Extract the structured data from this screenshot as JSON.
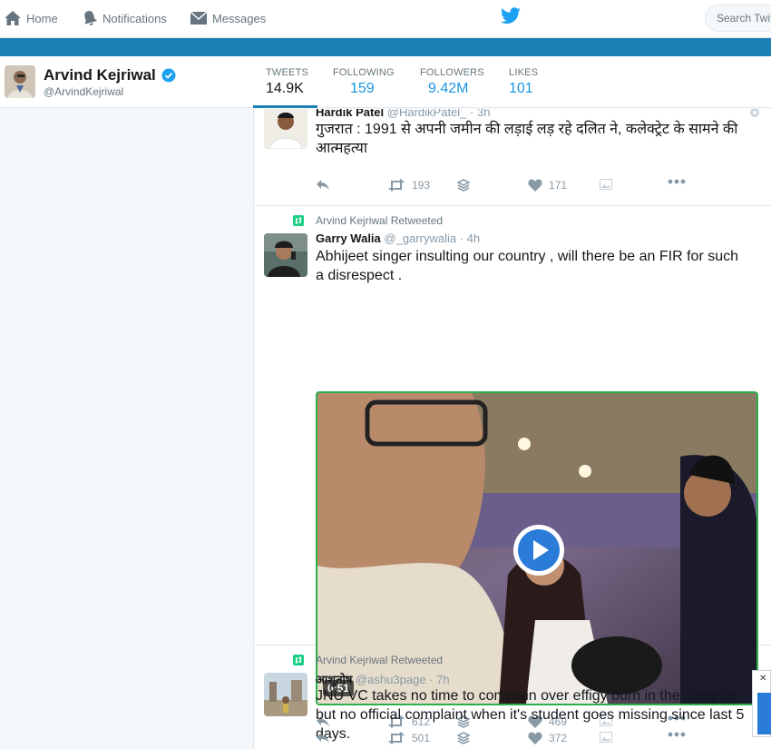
{
  "nav": {
    "home": "Home",
    "notifications": "Notifications",
    "messages": "Messages",
    "search_placeholder": "Search Twitter"
  },
  "colors": {
    "accent": "#1b95e0",
    "banner": "#1b80b4",
    "video_border": "#2db04b"
  },
  "profile": {
    "name": "Arvind Kejriwal",
    "handle": "@ArvindKejriwal",
    "stats": [
      {
        "label": "TWEETS",
        "value": "14.9K"
      },
      {
        "label": "FOLLOWING",
        "value": "159"
      },
      {
        "label": "FOLLOWERS",
        "value": "9.42M"
      },
      {
        "label": "LIKES",
        "value": "101"
      }
    ]
  },
  "tweets": [
    {
      "name": "Hardik Patel",
      "handle": "@HardikPatel_",
      "time": "· 3h",
      "text": "गुजरात : 1991 से अपनी जमीन की लड़ाई लड़ रहे दलित ने, कलेक्ट्रेट के सामने की आत्महत्या",
      "retweets": "193",
      "likes": "171"
    },
    {
      "retweeted_by": "Arvind Kejriwal Retweeted",
      "name": "Garry Walia",
      "handle": "@_garrywalia",
      "time": "· 4h",
      "text": "Abhijeet singer insulting our country , will there be an FIR for such a disrespect .",
      "video_duration": "0:51",
      "retweets": "612",
      "likes": "469"
    },
    {
      "retweeted_by": "Arvind Kejriwal Retweeted",
      "name": "आशुतोष",
      "handle": "@ashu3page",
      "time": "· 7h",
      "text": "JNU VC takes no time to complain over effigy burn in the campus, but no official complaint when it's student goes missing since last 5 days.",
      "retweets": "501",
      "likes": "372"
    }
  ]
}
